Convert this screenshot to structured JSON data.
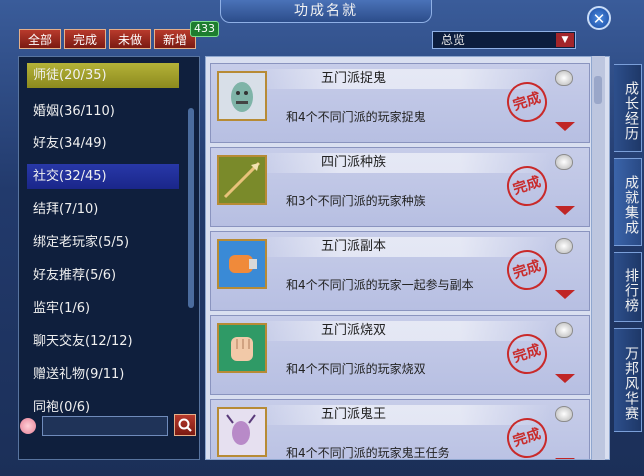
{
  "window": {
    "title": "功成名就",
    "close_label": "✕"
  },
  "filters": [
    "全部",
    "完成",
    "未做",
    "新增"
  ],
  "new_count": "433",
  "dropdown": {
    "selected": "总览",
    "arrow": "▼"
  },
  "categories": [
    "师徒(20/35)",
    "婚姻(36/110)",
    "好友(34/49)",
    "社交(32/45)",
    "结拜(7/10)",
    "绑定老玩家(5/5)",
    "好友推荐(5/6)",
    "监牢(1/6)",
    "聊天交友(12/12)",
    "赠送礼物(9/11)",
    "同袍(0/6)"
  ],
  "side_tabs": [
    "成长经历",
    "成就集成",
    "排行榜",
    "万邦风华赛"
  ],
  "achievements": [
    {
      "title": "五门派捉鬼",
      "desc": "和4个不同门派的玩家捉鬼",
      "stamp": "完成",
      "icon": "ghost-icon"
    },
    {
      "title": "四门派种族",
      "desc": "和3个不同门派的玩家种族",
      "stamp": "完成",
      "icon": "arrow-icon"
    },
    {
      "title": "五门派副本",
      "desc": "和4个不同门派的玩家一起参与副本",
      "stamp": "完成",
      "icon": "fist-icon"
    },
    {
      "title": "五门派烧双",
      "desc": "和4个不同门派的玩家烧双",
      "stamp": "完成",
      "icon": "hand-icon"
    },
    {
      "title": "五门派鬼王",
      "desc": "和4个不同门派的玩家鬼王任务",
      "stamp": "完成",
      "icon": "creature-icon"
    }
  ]
}
